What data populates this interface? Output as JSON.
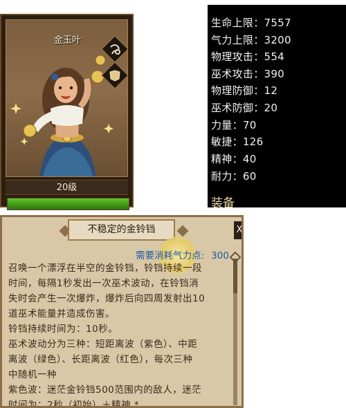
{
  "character": {
    "name": "金玉叶",
    "level": "20级",
    "xp_fraction": 1.0,
    "icons": [
      "rope-icon",
      "armor-icon"
    ]
  },
  "stats": {
    "rows": [
      "生命上限：7557",
      "气力上限：3200",
      "物理攻击：554",
      "巫术攻击：390",
      "物理防御：12",
      "巫术防御：20",
      "力量：70",
      "敏捷：126",
      "精神：40",
      "耐力：60"
    ],
    "equipment_label": "装备"
  },
  "skill": {
    "title": "不稳定的金铃铛",
    "cost_label": "需要消耗气力点:",
    "cost_value": "300",
    "close_label": "X",
    "lines": [
      "召唤一个漂浮在半空的金铃铛，铃铛持续一段",
      "时间，每隔1秒发出一次巫术波动，在铃铛消",
      "失时会产生一次爆炸，爆炸后向四周发射出10",
      "道巫术能量并造成伤害。",
      "铃铛持续时间为：10秒。",
      "巫术波动分为三种：短距离波（紫色）、中距",
      "离波（绿色）、长距离波（红色），每次三种",
      "中随机一种",
      "紫色波：迷茫金铃铛500范围内的敌人，迷茫",
      "时间为：2秒（初始）＋精神 *"
    ]
  },
  "colors": {
    "card_frame": "#6b4a26",
    "xp_green": "#4fa81d",
    "stats_bg": "#000000",
    "stats_text": "#f2f2f2",
    "equip_text": "#f0d7a4",
    "parchment": "#d8c8a8",
    "cost_blue": "#1f5aa3"
  }
}
